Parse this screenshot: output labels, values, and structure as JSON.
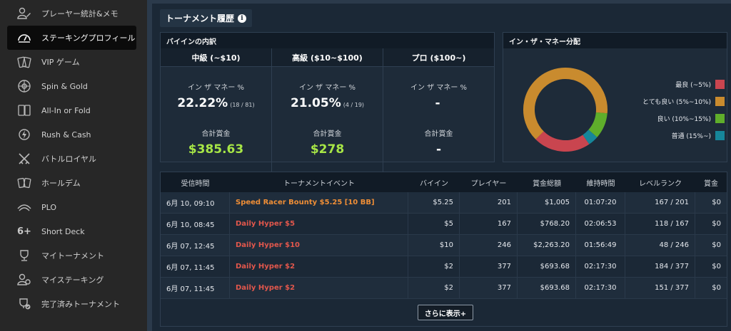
{
  "sidebar": {
    "items": [
      {
        "label": "プレーヤー統計&メモ",
        "icon": "player-stats-icon"
      },
      {
        "label": "ステーキングプロフィール",
        "icon": "gauge-icon",
        "active": true
      },
      {
        "label": "VIP ゲーム",
        "icon": "vip-cards-icon"
      },
      {
        "label": "Spin & Gold",
        "icon": "spin-wheel-icon"
      },
      {
        "label": "All-In or Fold",
        "icon": "all-in-cards-icon"
      },
      {
        "label": "Rush & Cash",
        "icon": "rush-cash-icon"
      },
      {
        "label": "バトルロイヤル",
        "icon": "crossed-swords-icon"
      },
      {
        "label": "ホールデム",
        "icon": "holdem-cards-icon"
      },
      {
        "label": "PLO",
        "icon": "plo-cards-icon"
      },
      {
        "label": "Short Deck",
        "icon": "six-plus-icon"
      },
      {
        "label": "マイトーナメント",
        "icon": "trophy-icon"
      },
      {
        "label": "マイステーキング",
        "icon": "my-staking-icon"
      },
      {
        "label": "完了済みトーナメント",
        "icon": "completed-trophy-icon"
      }
    ]
  },
  "header": {
    "title": "トーナメント履歴",
    "info_icon": "i"
  },
  "buyin": {
    "title": "バイインの内訳",
    "columns": [
      {
        "name": "中級 (~$10)",
        "itm_label": "イン ザ マネー %",
        "itm_value": "22.22%",
        "itm_count": "(18 / 81)",
        "prize_label": "合計賞金",
        "prize_value": "$385.63"
      },
      {
        "name": "高級 ($10~$100)",
        "itm_label": "イン ザ マネー %",
        "itm_value": "21.05%",
        "itm_count": "(4 / 19)",
        "prize_label": "合計賞金",
        "prize_value": "$278"
      },
      {
        "name": "プロ ($100~)",
        "itm_label": "イン ザ マネー %",
        "itm_value": "-",
        "itm_count": "",
        "prize_label": "合計賞金",
        "prize_value": "-"
      }
    ]
  },
  "itm_distribution": {
    "title": "イン・ザ・マネー分配",
    "legend": [
      {
        "label": "最良 (~5%)",
        "color": "#c9454f"
      },
      {
        "label": "とても良い (5%~10%)",
        "color": "#c98b2e"
      },
      {
        "label": "良い (10%~15%)",
        "color": "#5fae2b"
      },
      {
        "label": "普通 (15%~)",
        "color": "#16869a"
      }
    ]
  },
  "chart_data": {
    "type": "pie",
    "categories": [
      "最良 (~5%)",
      "とても良い (5%~10%)",
      "良い (10%~15%)",
      "普通 (15%~)"
    ],
    "values": [
      22,
      64,
      10,
      4
    ],
    "colors": [
      "#c9454f",
      "#c98b2e",
      "#5fae2b",
      "#16869a"
    ],
    "donut": true
  },
  "table": {
    "headers": [
      "受信時間",
      "トーナメントイベント",
      "バイイン",
      "プレイヤー",
      "賞金総額",
      "維持時間",
      "レベルランク",
      "賞金"
    ],
    "rows": [
      {
        "time": "6月 10, 09:10",
        "event": "Speed Racer Bounty $5.25 [10 BB]",
        "buyin": "$5.25",
        "players": "201",
        "pool": "$1,005",
        "duration": "01:07:20",
        "rank": "167 / 201",
        "prize": "$0"
      },
      {
        "time": "6月 10, 08:45",
        "event": "Daily Hyper $5",
        "buyin": "$5",
        "players": "167",
        "pool": "$768.20",
        "duration": "02:06:53",
        "rank": "118 / 167",
        "prize": "$0"
      },
      {
        "time": "6月 07, 12:45",
        "event": "Daily Hyper $10",
        "buyin": "$10",
        "players": "246",
        "pool": "$2,263.20",
        "duration": "01:56:49",
        "rank": "48 / 246",
        "prize": "$0"
      },
      {
        "time": "6月 07, 11:45",
        "event": "Daily Hyper $2",
        "buyin": "$2",
        "players": "377",
        "pool": "$693.68",
        "duration": "02:17:30",
        "rank": "184 / 377",
        "prize": "$0"
      },
      {
        "time": "6月 07, 11:45",
        "event": "Daily Hyper $2",
        "buyin": "$2",
        "players": "377",
        "pool": "$693.68",
        "duration": "02:17:30",
        "rank": "151 / 377",
        "prize": "$0"
      }
    ],
    "more_label": "さらに表示+"
  }
}
